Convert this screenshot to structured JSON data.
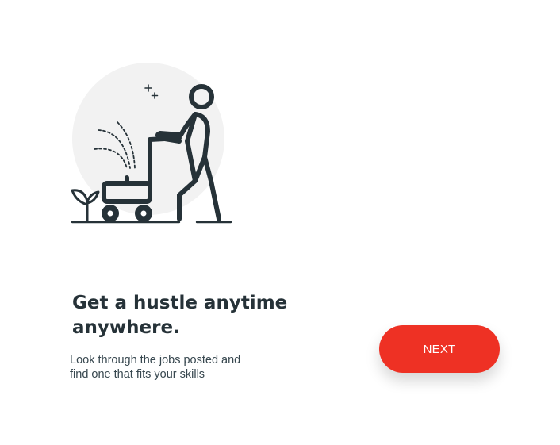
{
  "onboarding": {
    "illustration_icon": "person-pushing-lawn-mower-icon",
    "headline": "Get a hustle anytime anywhere.",
    "subtext_line1": "Look through the jobs posted and",
    "subtext_line2": "find one that fits your skills",
    "next_label": "NEXT"
  },
  "colors": {
    "accent": "#ee3124",
    "text_dark": "#263238",
    "illustration_stroke": "#263238",
    "illustration_bg": "#f2f2f2"
  }
}
